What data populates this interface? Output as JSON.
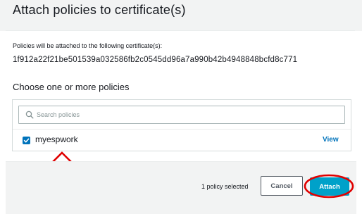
{
  "dialog": {
    "title": "Attach policies to certificate(s)"
  },
  "certificate_info": {
    "label": "Policies will be attached to the following certificate(s):",
    "id": "1f912a22f21be501539a032586fb2c0545dd96a7a990b42b4948848bcfd8c771"
  },
  "policies": {
    "section_title": "Choose one or more policies",
    "search_placeholder": "Search policies",
    "items": [
      {
        "name": "myespwork",
        "checked": true,
        "view_label": "View"
      }
    ]
  },
  "footer": {
    "selection_status": "1 policy selected",
    "cancel_label": "Cancel",
    "attach_label": "Attach"
  },
  "colors": {
    "accent": "#00a1c9",
    "link": "#0073bb",
    "checkbox": "#0073bb",
    "annotation": "#e00000",
    "header_bg": "#f2f3f3"
  },
  "icons": {
    "search": "search-icon",
    "checkbox_checked": "checkmark-icon",
    "annotation_arrow": "arrow-up-icon"
  }
}
